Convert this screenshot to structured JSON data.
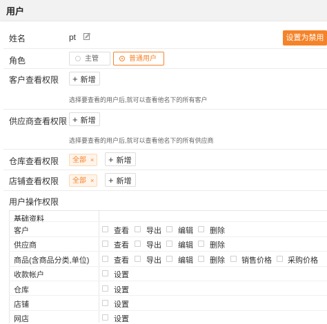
{
  "header": {
    "title": "用户"
  },
  "name": {
    "label": "姓名",
    "value": "pt"
  },
  "disable_button": "设置为禁用",
  "role": {
    "label": "角色",
    "options": [
      {
        "label": "主管",
        "selected": false
      },
      {
        "label": "普通用户",
        "selected": true
      }
    ]
  },
  "customer_perm": {
    "label": "客户查看权限",
    "add_label": "新增",
    "hint": "选择要查看的用户后,就可以查看他名下的所有客户"
  },
  "supplier_perm": {
    "label": "供应商查看权限",
    "add_label": "新增",
    "hint": "选择要查看的用户后,就可以查看他名下的所有供应商"
  },
  "warehouse_perm": {
    "label": "仓库查看权限",
    "tag": "全部",
    "add_label": "新增"
  },
  "store_perm": {
    "label": "店铺查看权限",
    "tag": "全部",
    "add_label": "新增"
  },
  "user_ops": {
    "label": "用户操作权限",
    "section": "基础资料",
    "rows": [
      {
        "name": "客户",
        "actions": [
          "查看",
          "导出",
          "编辑",
          "删除"
        ]
      },
      {
        "name": "供应商",
        "actions": [
          "查看",
          "导出",
          "编辑",
          "删除"
        ]
      },
      {
        "name": "商品(含商品分类,单位)",
        "actions": [
          "查看",
          "导出",
          "编辑",
          "删除",
          "销售价格",
          "采购价格"
        ]
      },
      {
        "name": "收款帐户",
        "actions": [
          "设置"
        ]
      },
      {
        "name": "仓库",
        "actions": [
          "设置"
        ]
      },
      {
        "name": "店铺",
        "actions": [
          "设置"
        ]
      },
      {
        "name": "网店",
        "actions": [
          "设置"
        ]
      }
    ]
  },
  "colors": {
    "accent": "#f5832a",
    "header_bg": "#f2f2f2"
  }
}
